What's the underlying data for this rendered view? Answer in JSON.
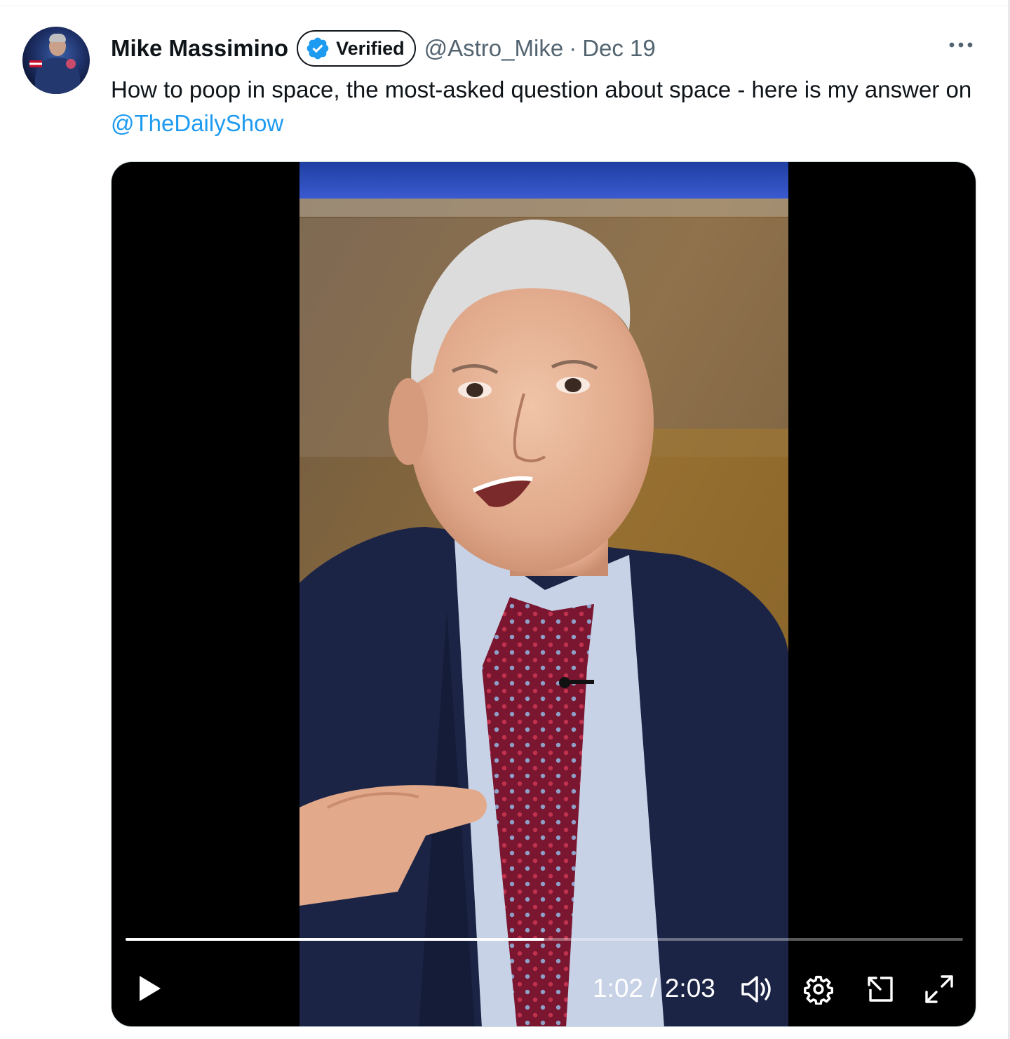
{
  "tweet": {
    "author_name": "Mike Massimino",
    "verified_label": "Verified",
    "handle": "@Astro_Mike",
    "separator": "·",
    "date": "Dec 19",
    "text_before": "How to poop in space, the most-asked question about space - here is my answer on ",
    "mention": "@TheDailyShow"
  },
  "video": {
    "current_time": "1:02",
    "time_separator": " / ",
    "duration": "2:03",
    "progress_fraction": 0.5
  },
  "icons": {
    "avatar": "profile-photo",
    "verified": "verified-check-badge",
    "more": "more-dots-icon",
    "play": "play-icon",
    "volume": "volume-icon",
    "settings": "gear-icon",
    "pip": "picture-in-picture-icon",
    "fullscreen": "fullscreen-icon"
  },
  "colors": {
    "link": "#1d9bf0",
    "verified_badge": "#1d9bf0",
    "secondary_text": "#536471",
    "primary_text": "#0f1419"
  }
}
